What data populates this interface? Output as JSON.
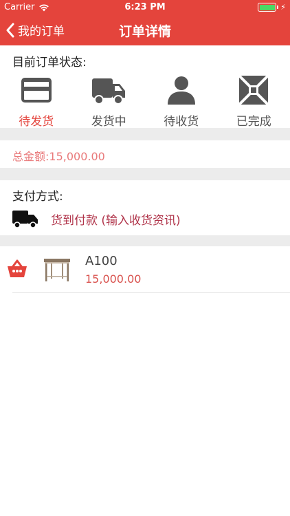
{
  "status_bar": {
    "carrier": "Carrier",
    "time": "6:23 PM"
  },
  "nav": {
    "back_label": "我的订单",
    "title": "订单详情"
  },
  "order_status": {
    "heading": "目前订单状态:",
    "items": [
      {
        "label": "待发货",
        "icon": "card-icon",
        "active": true
      },
      {
        "label": "发货中",
        "icon": "truck-icon",
        "active": false
      },
      {
        "label": "待收货",
        "icon": "person-icon",
        "active": false
      },
      {
        "label": "已完成",
        "icon": "complete-icon",
        "active": false
      }
    ]
  },
  "total": {
    "text": "总金额:15,000.00"
  },
  "payment": {
    "heading": "支付方式:",
    "method": "货到付款 (输入收货资讯)",
    "icon": "truck-icon"
  },
  "item": {
    "name": "A100",
    "price": "15,000.00",
    "icon": "basket-icon",
    "thumbnail": "table-thumbnail"
  },
  "colors": {
    "accent": "#e4443c",
    "active_label": "#e4443c",
    "total": "#e9797a",
    "payment_text": "#b0344a",
    "icon_gray": "#555555",
    "section_gap": "#ececec"
  }
}
